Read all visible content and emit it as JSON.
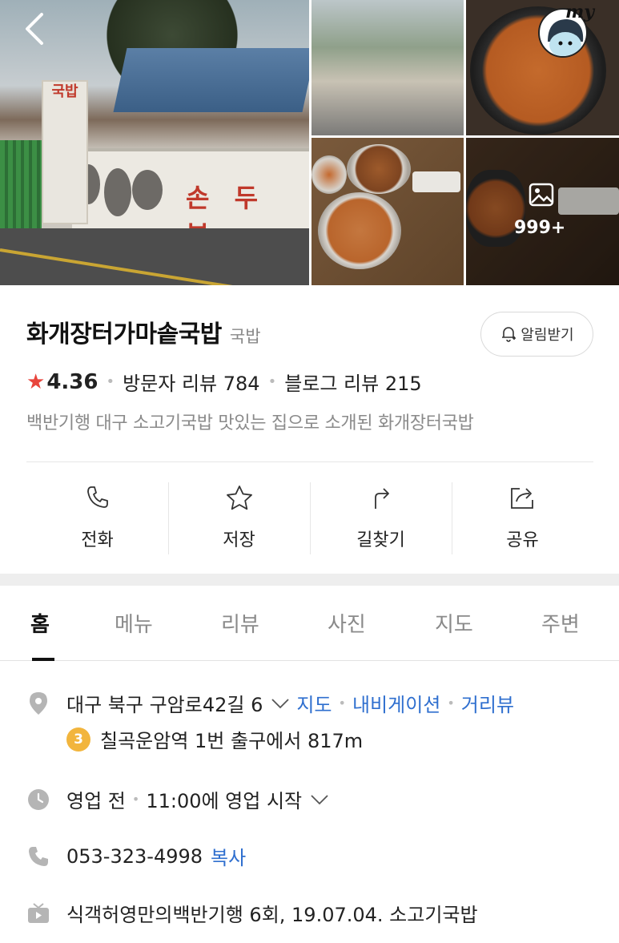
{
  "hero": {
    "photo_count": "999+",
    "main_sign_chars": "손 두 부",
    "main_sign_left": "국밥",
    "my_label": "my"
  },
  "place": {
    "name": "화개장터가마솥국밥",
    "category": "국밥",
    "notify_label": "알림받기",
    "rating": "4.36",
    "visitor_reviews": "방문자 리뷰 784",
    "blog_reviews": "블로그 리뷰 215",
    "description": "백반기행 대구 소고기국밥 맛있는 집으로 소개된 화개장터국밥"
  },
  "actions": [
    {
      "label": "전화",
      "icon": "phone-icon"
    },
    {
      "label": "저장",
      "icon": "star-icon"
    },
    {
      "label": "길찾기",
      "icon": "directions-icon"
    },
    {
      "label": "공유",
      "icon": "share-icon"
    }
  ],
  "tabs": [
    "홈",
    "메뉴",
    "리뷰",
    "사진",
    "지도",
    "주변"
  ],
  "active_tab": "홈",
  "details": {
    "address": "대구 북구 구암로42길 6",
    "map_link": "지도",
    "navi_link": "내비게이션",
    "streetview_link": "거리뷰",
    "subway_line": "3",
    "subway_text": "칠곡운암역 1번 출구에서 817m",
    "hours_status": "영업 전",
    "hours_text": "11:00에 영업 시작",
    "phone": "053-323-4998",
    "copy_label": "복사",
    "tv_info": "식객허영만의백반기행 6회, 19.07.04. 소고기국밥"
  },
  "colors": {
    "link": "#2f6fcf",
    "star": "#e8453c",
    "subway_line3": "#f2b53d"
  }
}
